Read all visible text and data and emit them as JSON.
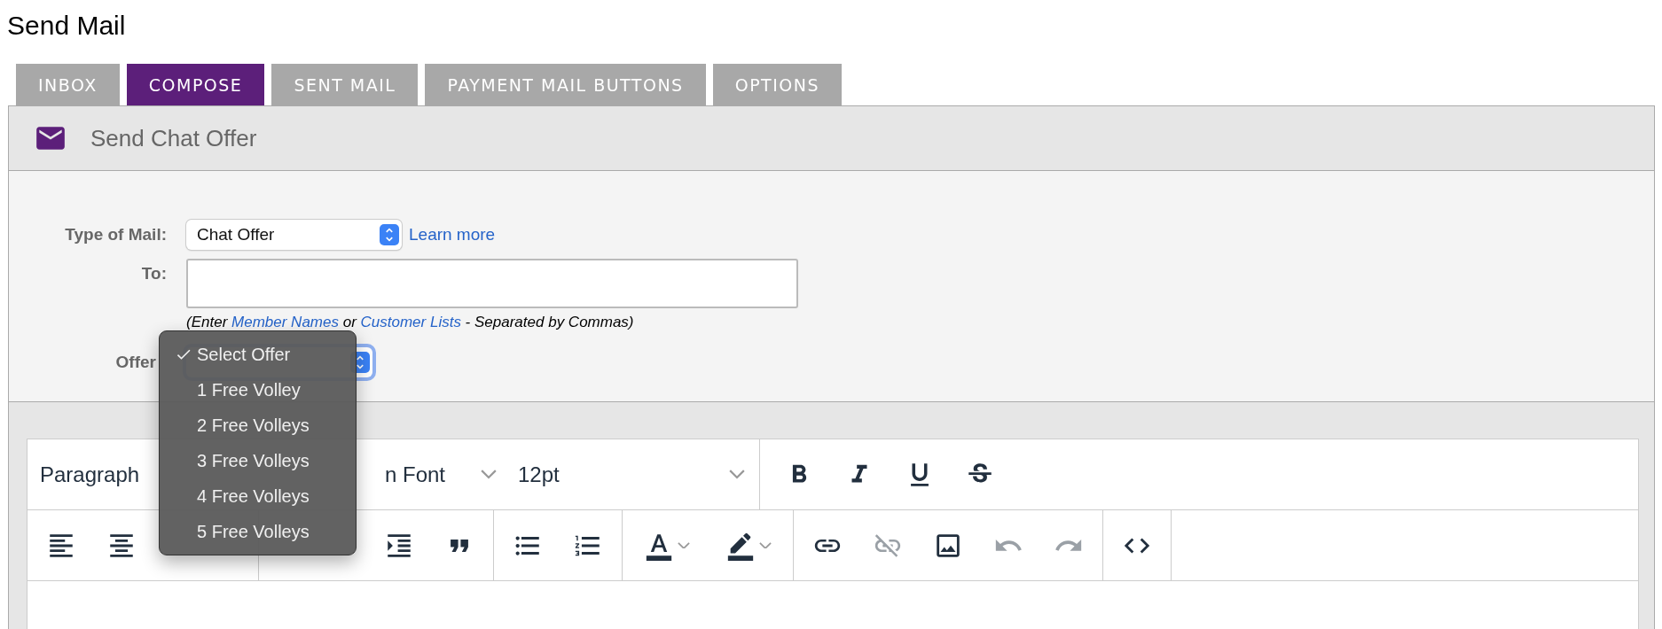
{
  "page_title": "Send Mail",
  "tabs": [
    {
      "label": "INBOX",
      "selected": false
    },
    {
      "label": "COMPOSE",
      "selected": true
    },
    {
      "label": "SENT MAIL",
      "selected": false
    },
    {
      "label": "PAYMENT MAIL BUTTONS",
      "selected": false
    },
    {
      "label": "OPTIONS",
      "selected": false
    }
  ],
  "panel_title": "Send Chat Offer",
  "form": {
    "type_of_mail": {
      "label": "Type of Mail:",
      "value": "Chat Offer",
      "link": "Learn more"
    },
    "to": {
      "label": "To:",
      "hint": [
        {
          "kind": "text",
          "text": "(Enter "
        },
        {
          "kind": "link",
          "text": "Member Names"
        },
        {
          "kind": "text",
          "text": " or "
        },
        {
          "kind": "link",
          "text": "Customer Lists"
        },
        {
          "kind": "text",
          "text": " - Separated by Commas)"
        }
      ]
    },
    "offer": {
      "label": "Offer",
      "focused": true,
      "menu_open": true,
      "options": [
        {
          "label": "Select Offer",
          "selected": true
        },
        {
          "label": "1 Free Volley",
          "selected": false
        },
        {
          "label": "2 Free Volleys",
          "selected": false
        },
        {
          "label": "3 Free Volleys",
          "selected": false
        },
        {
          "label": "4 Free Volleys",
          "selected": false
        },
        {
          "label": "5 Free Volleys",
          "selected": false
        }
      ]
    }
  },
  "editor": {
    "selects": [
      {
        "value": "Paragraph"
      },
      {
        "value": "n Font"
      },
      {
        "value": "12pt"
      }
    ],
    "row_1_groups": [
      [
        {
          "kind": "bold",
          "disabled": false
        },
        {
          "kind": "italic",
          "disabled": false
        },
        {
          "kind": "underline",
          "disabled": false
        },
        {
          "kind": "strikethrough",
          "disabled": false
        }
      ]
    ],
    "row_2_groups": [
      [
        {
          "kind": "align-left",
          "disabled": false
        },
        {
          "kind": "align-center",
          "disabled": false
        }
      ],
      [
        {
          "kind": "indent",
          "disabled": false
        },
        {
          "kind": "blockquote",
          "disabled": false
        }
      ],
      [
        {
          "kind": "bullet-list",
          "disabled": false
        },
        {
          "kind": "numbered-list",
          "disabled": false
        }
      ],
      [
        {
          "kind": "text-color",
          "disabled": false
        },
        {
          "kind": "highlight",
          "disabled": false
        }
      ],
      [
        {
          "kind": "link",
          "disabled": false
        },
        {
          "kind": "unlink",
          "disabled": true
        },
        {
          "kind": "image",
          "disabled": false
        },
        {
          "kind": "undo",
          "disabled": true
        },
        {
          "kind": "redo",
          "disabled": true
        }
      ],
      [
        {
          "kind": "code",
          "disabled": false
        }
      ]
    ]
  }
}
